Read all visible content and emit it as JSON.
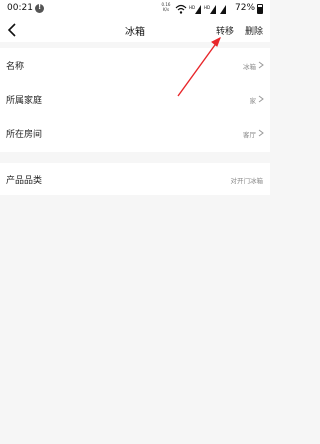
{
  "status_bar": {
    "time": "00:21",
    "network_speed": "0.16\nK/s",
    "battery_percent": "72%"
  },
  "nav": {
    "title": "冰箱",
    "transfer_label": "转移",
    "delete_label": "删除"
  },
  "rows": [
    {
      "label": "名称",
      "value": "冰箱"
    },
    {
      "label": "所属家庭",
      "value": "家"
    },
    {
      "label": "所在房间",
      "value": "客厅"
    }
  ],
  "product": {
    "label": "产品品类",
    "value": "对开门冰箱"
  },
  "annotation": {
    "arrow_color": "#e8262a"
  },
  "colors": {
    "background": "#f6f6f6",
    "card": "#ffffff",
    "secondary_text": "#888888"
  }
}
